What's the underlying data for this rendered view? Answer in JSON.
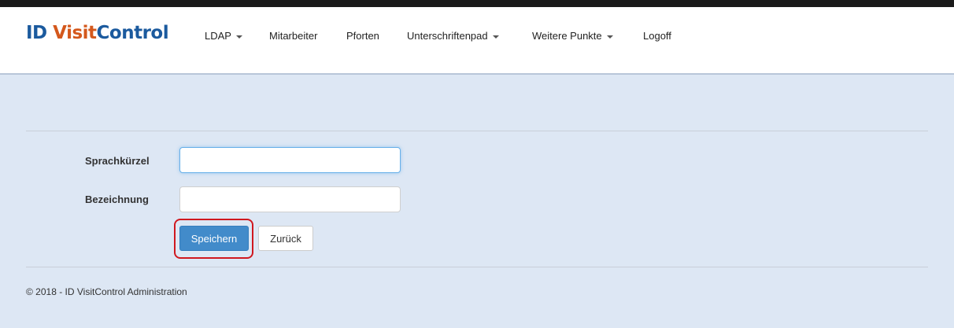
{
  "brand": {
    "part1": "ID ",
    "part2": "Visit",
    "part3": "Control"
  },
  "nav": {
    "ldap": "LDAP",
    "mitarbeiter": "Mitarbeiter",
    "pforten": "Pforten",
    "unterschriftenpad": "Unterschriftenpad",
    "weitere_punkte": "Weitere Punkte",
    "logoff": "Logoff"
  },
  "form": {
    "field1_label": "Sprachkürzel",
    "field1_value": "",
    "field2_label": "Bezeichnung",
    "field2_value": "",
    "save_label": "Speichern",
    "back_label": "Zurück"
  },
  "footer": {
    "text": "© 2018 - ID VisitControl Administration"
  },
  "colors": {
    "brand_blue": "#1b5a9e",
    "brand_orange": "#d4581c",
    "page_background": "#dde7f4",
    "primary_button": "#428bca",
    "highlight": "#d0181f"
  }
}
